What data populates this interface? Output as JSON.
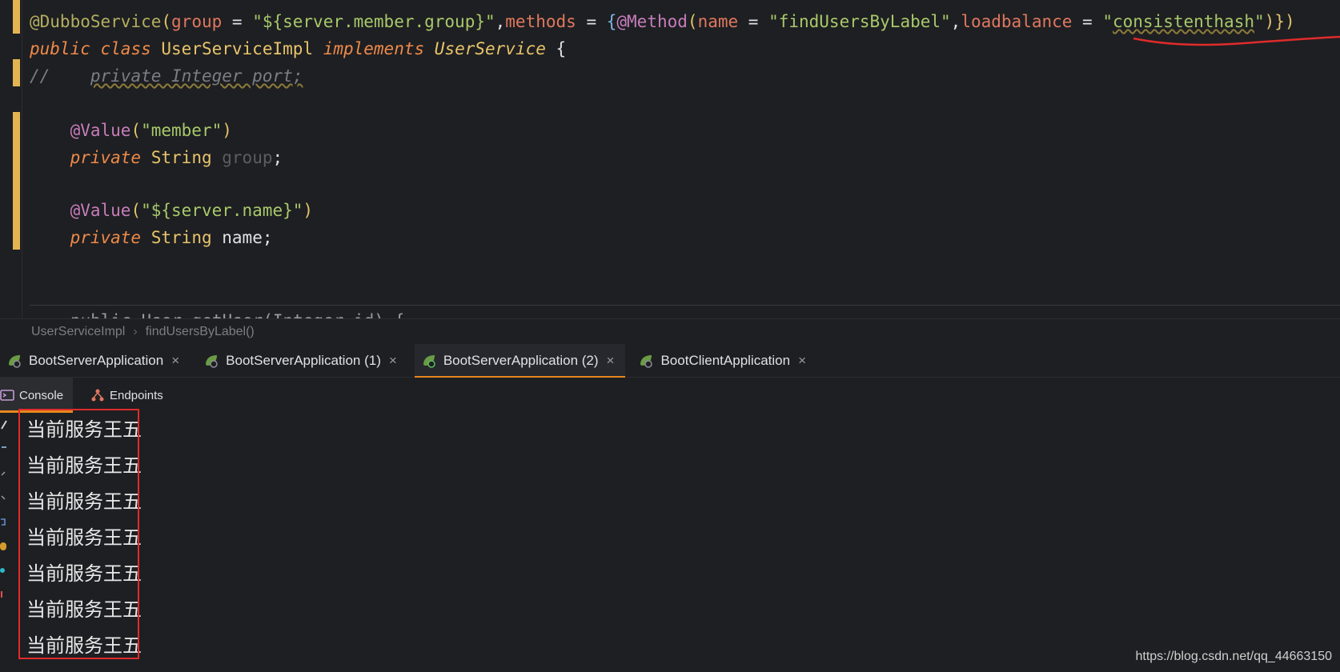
{
  "editor": {
    "line1": {
      "ann": "@DubboService",
      "p1": "(",
      "group_key": "group",
      "eq1": " = ",
      "group_val": "\"${server.member.group}\"",
      "comma1": ",",
      "methods_key": "methods",
      "eq2": " = ",
      "brace_open": "{",
      "method_ann": "@Method",
      "p2": "(",
      "name_key": "name",
      "eq3": " = ",
      "name_val": "\"findUsersByLabel\"",
      "comma2": ",",
      "lb_key": "loadbalance",
      "eq4": " = ",
      "lb_q1": "\"",
      "lb_val": "consistenthash",
      "lb_q2": "\"",
      "close": ")})"
    },
    "line2": {
      "kw1": "public",
      "kw2": "class",
      "cls": "UserServiceImpl",
      "kw3": "implements",
      "iface": "UserService",
      "brace": "{"
    },
    "line3": {
      "slashes": "//",
      "text": "private Integer port;"
    },
    "line4": {
      "ann": "@Value",
      "open": "(",
      "val": "\"member\"",
      "close": ")"
    },
    "line5": {
      "kw": "private",
      "type": "String",
      "field": "group",
      "semi": ";"
    },
    "line6": {
      "ann": "@Value",
      "open": "(",
      "val": "\"${server.name}\"",
      "close": ")"
    },
    "line7": {
      "kw": "private",
      "type": "String",
      "field": "name;"
    },
    "cutoff": "public User getUser(Integer id) {"
  },
  "breadcrumb": {
    "class": "UserServiceImpl",
    "method": "findUsersByLabel()"
  },
  "run_tabs": [
    {
      "label": "BootServerApplication",
      "active": false
    },
    {
      "label": "BootServerApplication (1)",
      "active": false
    },
    {
      "label": "BootServerApplication (2)",
      "active": true
    },
    {
      "label": "BootClientApplication",
      "active": false
    }
  ],
  "close_glyph": "×",
  "console_tabs": {
    "console": "Console",
    "endpoints": "Endpoints"
  },
  "console_output": [
    "当前服务王五",
    "当前服务王五",
    "当前服务王五",
    "当前服务王五",
    "当前服务王五",
    "当前服务王五",
    "当前服务王五"
  ],
  "watermark": "https://blog.csdn.net/qq_44663150",
  "colors": {
    "accent_tab": "#e8871e",
    "highlight_box": "#e02b2b",
    "change_marker": "#e2b552"
  }
}
